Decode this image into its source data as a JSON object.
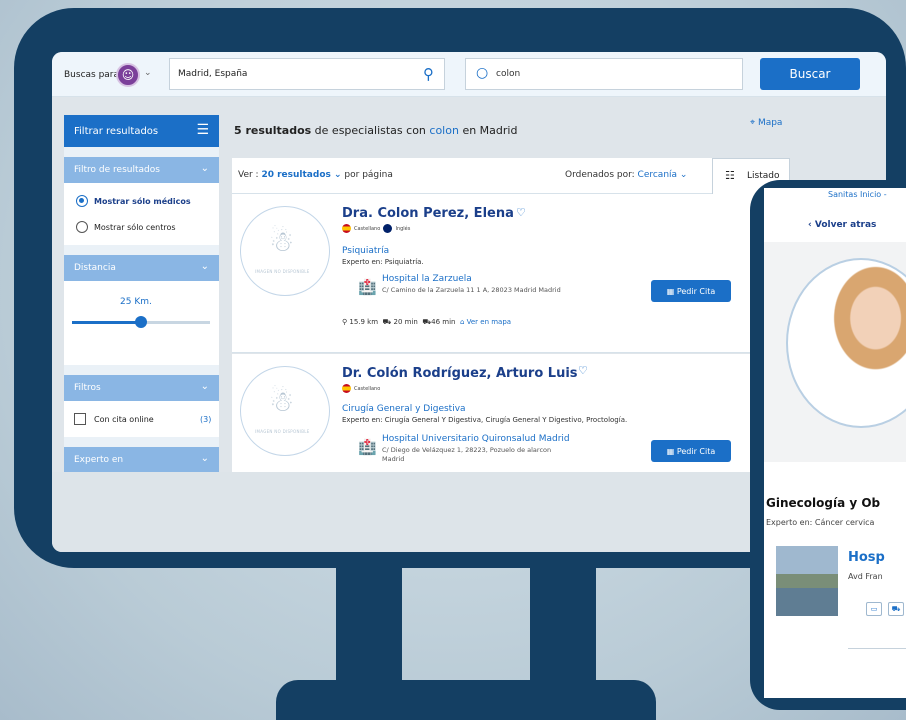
{
  "topbar": {
    "buscas_label": "Buscas para",
    "location_value": "Madrid, España",
    "search_value": "colon",
    "buscar_label": "Buscar"
  },
  "sidebar": {
    "filtrar_label": "Filtrar resultados",
    "filtro_header": "Filtro de resultados",
    "opt_medicos": "Mostrar sólo médicos",
    "opt_centros": "Mostrar sólo centros",
    "distancia_header": "Distancia",
    "distancia_value": "25 Km.",
    "distancia_fraction": 0.5,
    "filtros_header": "Filtros",
    "cita_online_label": "Con cita online",
    "cita_online_count": "(3)",
    "experto_header": "Experto en"
  },
  "main": {
    "results_count": "5 resultados",
    "results_mid": " de especialistas con ",
    "results_term": "colon",
    "results_end": " en Madrid",
    "ver_label": "Ver : ",
    "ver_value": "20 resultados",
    "ver_suffix": " por página",
    "ordenados_label": "Ordenados por: ",
    "ordenados_value": "Cercanía",
    "listado_label": "Listado",
    "mapa_label": "Mapa"
  },
  "doctors": [
    {
      "name": "Dra. Colon Perez, Elena",
      "lang1": "Castellano",
      "lang2": "Inglés",
      "specialty": "Psiquiatría",
      "expert": "Experto en: Psiquiatría.",
      "hospital": "Hospital la Zarzuela",
      "address": "C/ Camino de la Zarzuela 11 1 A, 28023 Madrid Madrid",
      "dist_km": "15.9 km",
      "dist_car": "20 min",
      "dist_bus": "46 min",
      "map_link": "Ver en mapa",
      "pedir": "Pedir Cita",
      "photo_text": "IMAGEN NO DISPONIBLE"
    },
    {
      "name": "Dr. Colón Rodríguez, Arturo Luis",
      "lang1": "Castellano",
      "specialty": "Cirugía General y Digestiva",
      "expert": "Experto en: Cirugía General Y Digestiva, Cirugía General Y Digestivo, Proctología.",
      "hospital": "Hospital Universitario Quironsalud Madrid",
      "address": "C/ Diego de Velázquez 1, 28223, Pozuelo de alarcon Madrid",
      "pedir": "Pedir Cita",
      "photo_text": "IMAGEN NO DISPONIBLE"
    }
  ],
  "phone": {
    "top_link": "Sanitas Inicio - ",
    "volver": "Volver atras",
    "specialty": "Ginecología y Ob",
    "expert": "Experto en: Cáncer cervica",
    "hospital": "Hosp",
    "address": "Avd Fran"
  },
  "icons": {
    "pin": "location-pin-icon",
    "search": "search-icon",
    "filter": "sliders-icon",
    "list": "list-icon",
    "map": "map-icon",
    "heart": "heart-icon",
    "hospital": "hospital-icon",
    "calendar": "calendar-icon"
  },
  "colors": {
    "primary": "#1b6fc7",
    "dark": "#143f63",
    "section": "#8ab6e4"
  }
}
